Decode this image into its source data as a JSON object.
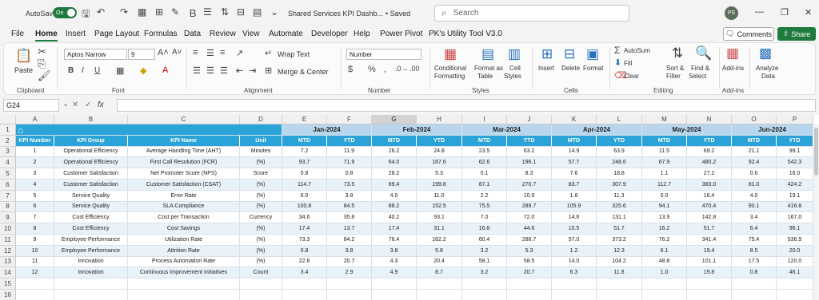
{
  "titlebar": {
    "autosave_label": "AutoSave",
    "autosave_state": "On",
    "doc_title": "Shared Services KPI Dashb...",
    "saved_label": "• Saved",
    "search_placeholder": "Search",
    "avatar_initials": "PS"
  },
  "menu": [
    "File",
    "Home",
    "Insert",
    "Page Layout",
    "Formulas",
    "Data",
    "Review",
    "View",
    "Automate",
    "Developer",
    "Help",
    "Power Pivot",
    "PK's Utility Tool V3.0"
  ],
  "buttons": {
    "comments": "Comments",
    "share": "Share"
  },
  "ribbon": {
    "paste": "Paste",
    "clipboard": "Clipboard",
    "font_name": "Aptos Narrow",
    "font_size": "9",
    "font": "Font",
    "wrap_text": "Wrap Text",
    "merge_center": "Merge & Center",
    "alignment": "Alignment",
    "number_format": "Number",
    "number": "Number",
    "conditional": "Conditional",
    "formatting": "Formatting",
    "format_as": "Format as",
    "table": "Table",
    "cell": "Cell",
    "styles_btn": "Styles",
    "styles": "Styles",
    "insert": "Insert",
    "delete": "Delete",
    "format": "Format",
    "cells": "Cells",
    "autosum": "AutoSum",
    "fill": "Fill",
    "clear": "Clear",
    "sort": "Sort &",
    "filter": "Filter",
    "find": "Find &",
    "select": "Select",
    "editing": "Editing",
    "addins": "Add-ins",
    "addins_grp": "Add-ins",
    "analyze": "Analyze",
    "data": "Data"
  },
  "formula_bar": {
    "name_box": "G24",
    "fx": "fx"
  },
  "columns": [
    "A",
    "B",
    "C",
    "D",
    "E",
    "F",
    "G",
    "H",
    "I",
    "J",
    "K",
    "L",
    "M",
    "N",
    "O",
    "P"
  ],
  "selected_column": "G",
  "header_row": [
    "KPI Number",
    "KPI Group",
    "KPI Name",
    "Unit"
  ],
  "months": [
    "Jan-2024",
    "Feb-2024",
    "Mar-2024",
    "Apr-2024",
    "May-2024",
    "Jun-2024"
  ],
  "sub_headers": [
    "MTD",
    "YTD"
  ],
  "rows": [
    [
      "1",
      "Operational Efficiency",
      "Average Handling Time (AHT)",
      "Minutes",
      "7.2",
      "11.9",
      "26.2",
      "24.8",
      "23.5",
      "63.2",
      "14.9",
      "63.9",
      "11.5",
      "69.2",
      "21.1",
      "99.1"
    ],
    [
      "2",
      "Operational Efficiency",
      "First Call Resolution (FCR)",
      "(%)",
      "93.7",
      "71.9",
      "64.0",
      "167.6",
      "62.6",
      "196.1",
      "57.7",
      "248.6",
      "67.9",
      "480.2",
      "92.4",
      "542.3"
    ],
    [
      "3",
      "Customer Satisfaction",
      "Net Promoter Score (NPS)",
      "Score",
      "0.8",
      "0.8",
      "28.2",
      "5.3",
      "0.1",
      "8.3",
      "7.6",
      "18.8",
      "1.1",
      "27.2",
      "0.6",
      "16.0"
    ],
    [
      "4",
      "Customer Satisfaction",
      "Customer Satisfaction (CSAT)",
      "(%)",
      "114.7",
      "73.5",
      "89.4",
      "199.8",
      "87.1",
      "270.7",
      "83.7",
      "307.9",
      "112.7",
      "383.0",
      "81.0",
      "424.2"
    ],
    [
      "5",
      "Service Quality",
      "Error Rate",
      "(%)",
      "6.0",
      "3.8",
      "4.0",
      "11.0",
      "2.2",
      "10.9",
      "1.8",
      "11.3",
      "0.0",
      "16.4",
      "4.0",
      "19.1"
    ],
    [
      "6",
      "Service Quality",
      "SLA Compliance",
      "(%)",
      "100.8",
      "84.5",
      "88.2",
      "152.5",
      "75.5",
      "289.7",
      "105.9",
      "325.6",
      "94.1",
      "470.4",
      "90.1",
      "416.8"
    ],
    [
      "7",
      "Cost Efficiency",
      "Cost per Transaction",
      "Currency",
      "34.6",
      "35.8",
      "40.2",
      "93.1",
      "7.0",
      "72.0",
      "14.6",
      "131.1",
      "13.9",
      "142.8",
      "3.4",
      "167.0"
    ],
    [
      "8",
      "Cost Efficiency",
      "Cost Savings",
      "(%)",
      "17.4",
      "13.7",
      "17.4",
      "31.1",
      "16.8",
      "44.6",
      "10.5",
      "51.7",
      "16.2",
      "51.7",
      "6.4",
      "96.1"
    ],
    [
      "9",
      "Employee Performance",
      "Utilization Rate",
      "(%)",
      "73.3",
      "84.2",
      "76.4",
      "162.2",
      "60.4",
      "286.7",
      "57.0",
      "373.2",
      "76.2",
      "341.4",
      "75.4",
      "536.9"
    ],
    [
      "10",
      "Employee Performance",
      "Attrition Rate",
      "(%)",
      "0.8",
      "3.8",
      "3.8",
      "5.8",
      "3.2",
      "5.3",
      "1.2",
      "12.3",
      "6.1",
      "19.4",
      "8.5",
      "20.0"
    ],
    [
      "11",
      "Innovation",
      "Process Automation Rate",
      "(%)",
      "22.8",
      "20.7",
      "4.3",
      "20.4",
      "58.1",
      "58.5",
      "14.0",
      "104.2",
      "48.8",
      "101.1",
      "17.5",
      "120.0"
    ],
    [
      "12",
      "Innovation",
      "Continuous Improvement Initiatives",
      "Count",
      "3.4",
      "2.9",
      "4.9",
      "8.7",
      "3.2",
      "20.7",
      "6.3",
      "11.8",
      "1.0",
      "19.8",
      "0.8",
      "46.1"
    ]
  ],
  "row_numbers": [
    "1",
    "2",
    "3",
    "4",
    "5",
    "6",
    "7",
    "8",
    "9",
    "10",
    "11",
    "12",
    "13",
    "14",
    "15",
    "16"
  ],
  "colors": {
    "accent_green": "#1f7a3f",
    "header_blue": "#2aa3d8",
    "month_blue": "#b8d7ee",
    "band": "#e9f2f9"
  }
}
